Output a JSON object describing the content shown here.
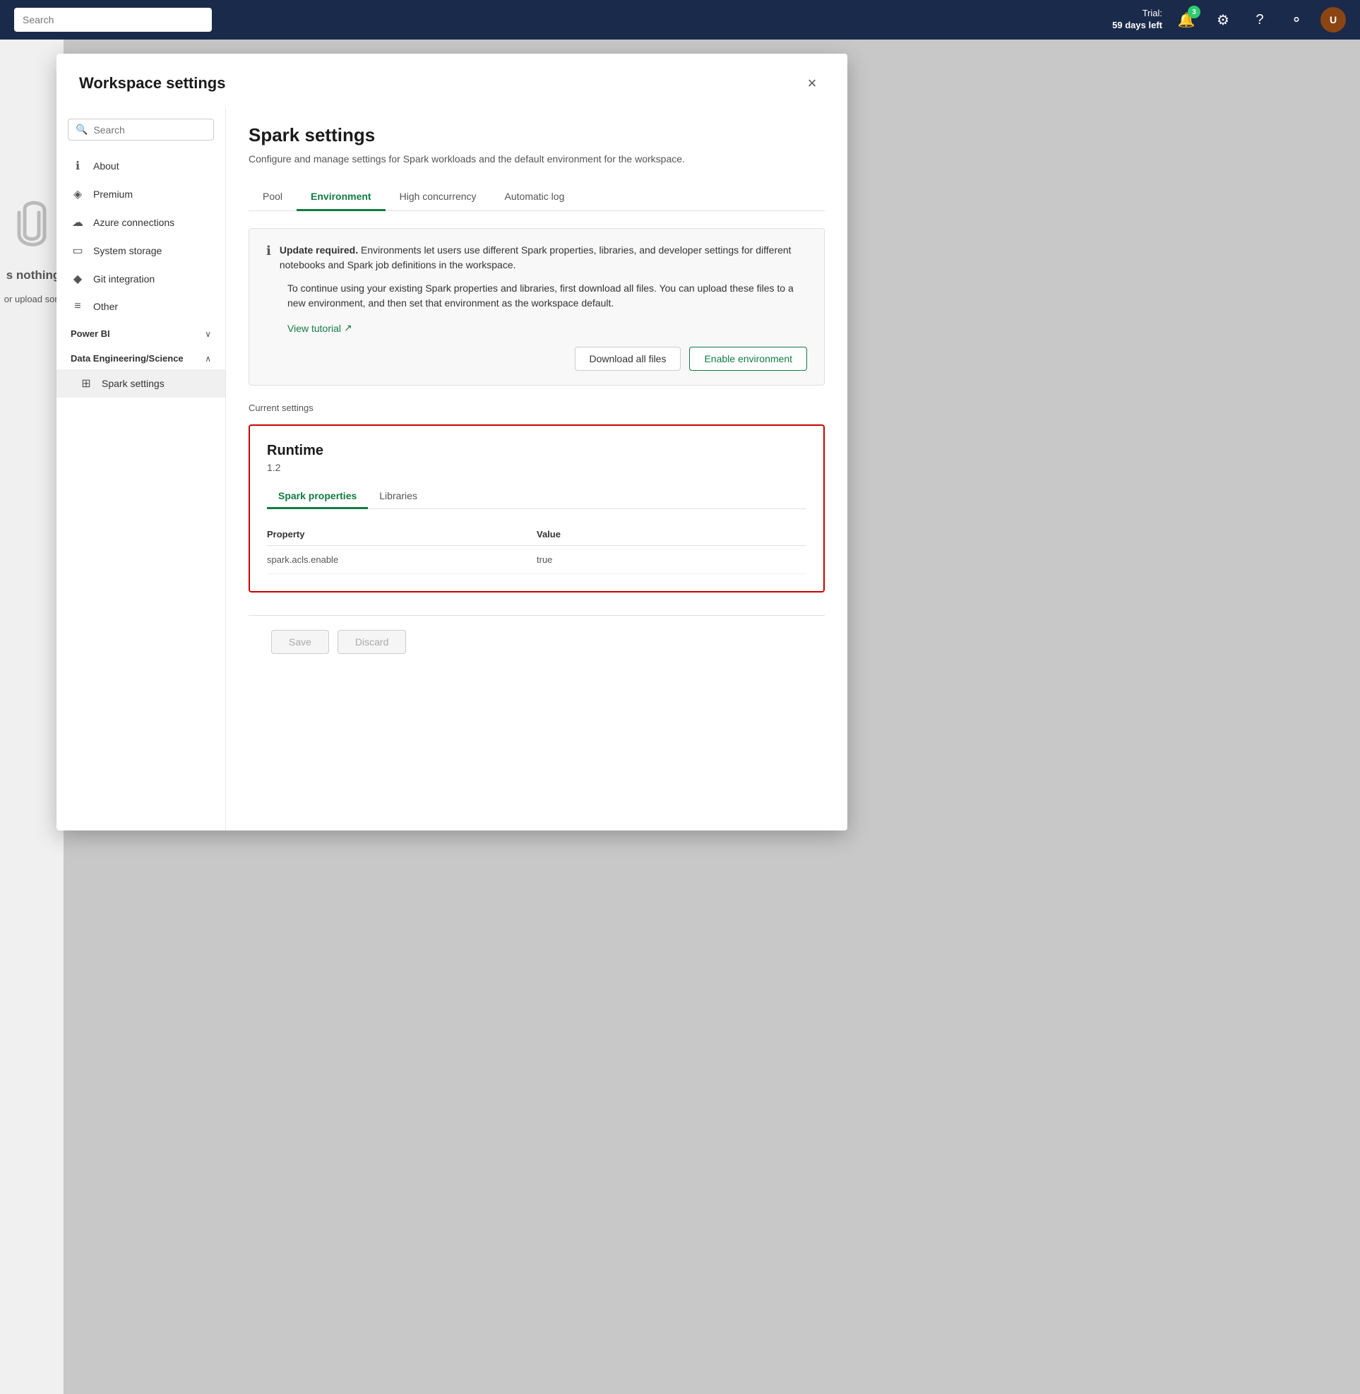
{
  "topnav": {
    "trial_label": "Trial:",
    "days_left": "59 days left",
    "badge_count": "3",
    "search_placeholder": "Search"
  },
  "modal": {
    "title": "Workspace settings",
    "close_label": "×"
  },
  "sidebar": {
    "search_placeholder": "Search",
    "items": [
      {
        "id": "about",
        "label": "About",
        "icon": "ℹ"
      },
      {
        "id": "premium",
        "label": "Premium",
        "icon": "◈"
      },
      {
        "id": "azure",
        "label": "Azure connections",
        "icon": "☁"
      },
      {
        "id": "storage",
        "label": "System storage",
        "icon": "▭"
      },
      {
        "id": "git",
        "label": "Git integration",
        "icon": "◆"
      },
      {
        "id": "other",
        "label": "Other",
        "icon": "≡"
      }
    ],
    "sections": [
      {
        "id": "powerbi",
        "label": "Power BI",
        "collapsed": true,
        "children": []
      },
      {
        "id": "data-engineering",
        "label": "Data Engineering/Science",
        "collapsed": false,
        "children": [
          {
            "id": "spark-settings",
            "label": "Spark settings",
            "icon": "⊞",
            "active": true
          }
        ]
      }
    ]
  },
  "main": {
    "title": "Spark settings",
    "description": "Configure and manage settings for Spark workloads and the default environment for the workspace.",
    "tabs": [
      {
        "id": "pool",
        "label": "Pool",
        "active": false
      },
      {
        "id": "environment",
        "label": "Environment",
        "active": true
      },
      {
        "id": "high-concurrency",
        "label": "High concurrency",
        "active": false
      },
      {
        "id": "automatic-log",
        "label": "Automatic log",
        "active": false
      }
    ],
    "alert": {
      "icon": "ℹ",
      "strong_text": "Update required.",
      "text": " Environments let users use different Spark properties, libraries, and developer settings for different notebooks and Spark job definitions in the workspace.",
      "body": "To continue using your existing Spark properties and libraries, first download all files. You can upload these files to a new environment, and then set that environment as the workspace default.",
      "tutorial_link": "View tutorial",
      "tutorial_icon": "↗",
      "btn_download": "Download all files",
      "btn_enable": "Enable environment"
    },
    "current_settings_label": "Current settings",
    "runtime": {
      "title": "Runtime",
      "version": "1.2",
      "inner_tabs": [
        {
          "id": "spark-props",
          "label": "Spark properties",
          "active": true
        },
        {
          "id": "libraries",
          "label": "Libraries",
          "active": false
        }
      ],
      "table": {
        "col_property": "Property",
        "col_value": "Value",
        "rows": [
          {
            "property": "spark.acls.enable",
            "value": "true"
          }
        ]
      }
    },
    "footer": {
      "save_label": "Save",
      "discard_label": "Discard"
    }
  },
  "background": {
    "nothing_text": "s nothing",
    "upload_text": "or upload som"
  }
}
